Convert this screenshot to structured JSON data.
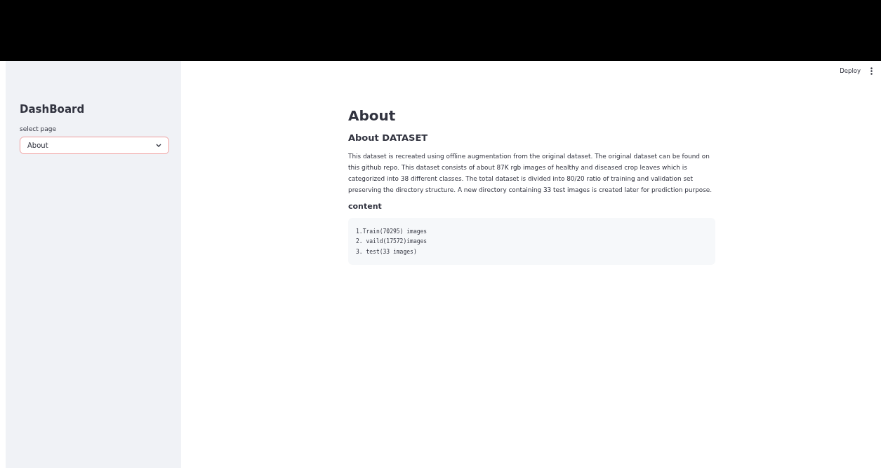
{
  "header": {
    "actions": [
      {
        "kind": "text",
        "label": "Deploy"
      },
      {
        "kind": "menu"
      }
    ]
  },
  "sidebar": {
    "title": "DashBoard",
    "select": {
      "label": "select page",
      "value": "About",
      "focused": true
    }
  },
  "main": {
    "title": "About",
    "subtitle": "About DATASET",
    "paragraph": "This dataset is recreated using offline augmentation from the original dataset. The original dataset can be found on this github repo. This dataset consists of about 87K rgb images of healthy and diseased crop leaves which is categorized into 38 different classes. The total dataset is divided into 80/20 ratio of training and validation set preserving the directory structure. A new directory containing 33 test images is created later for prediction purpose.",
    "section": "content",
    "code_lines": [
      "1.Train(70295) images",
      "2. vaild(17572)images",
      "3. test(33 images)"
    ]
  }
}
